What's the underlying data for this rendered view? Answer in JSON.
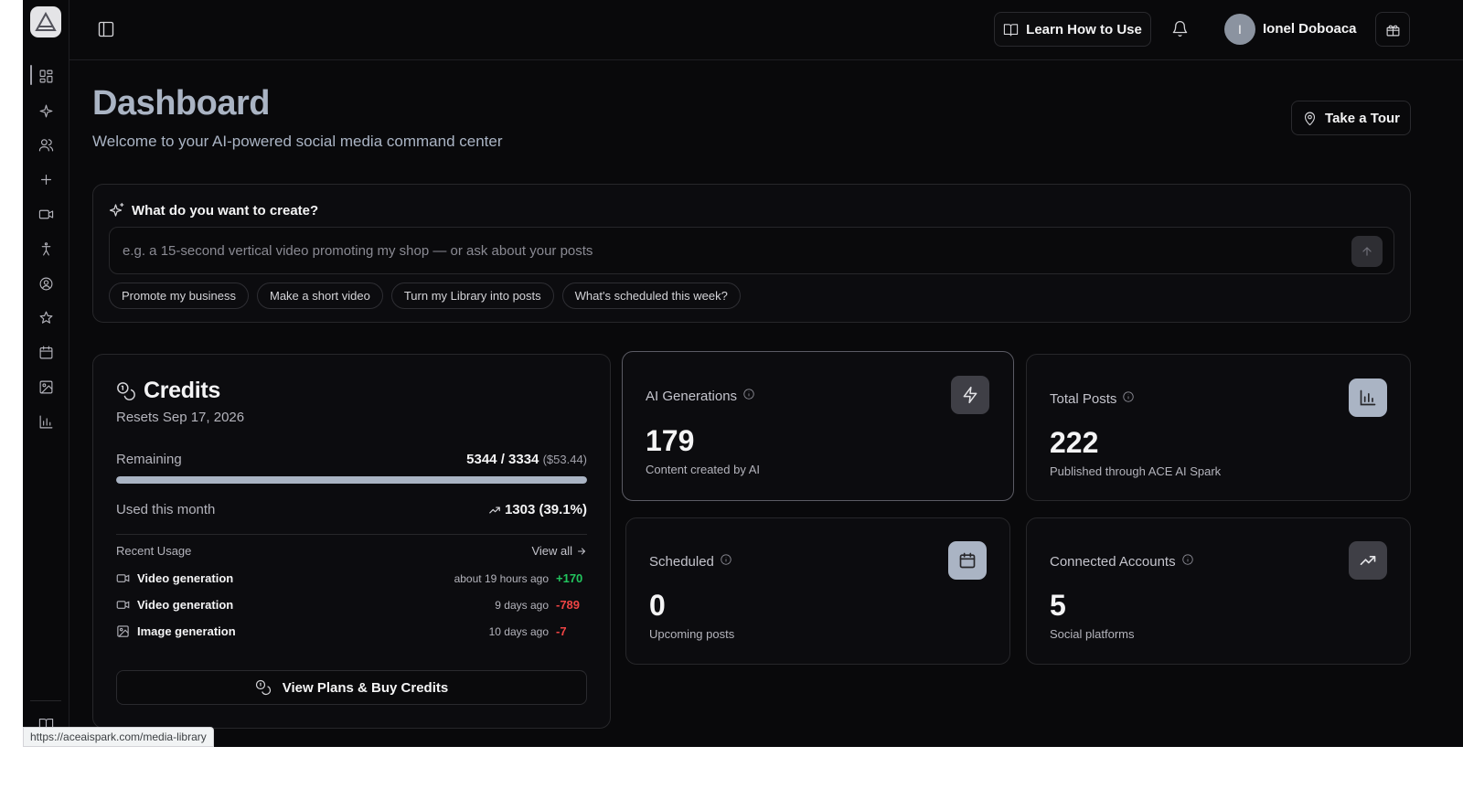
{
  "topbar": {
    "learn_label": "Learn How to Use",
    "user_initial": "I",
    "user_name": "Ionel Doboaca"
  },
  "header": {
    "title": "Dashboard",
    "subtitle": "Welcome to your AI-powered social media command center",
    "tour_label": "Take a Tour"
  },
  "create": {
    "title": "What do you want to create?",
    "placeholder": "e.g. a 15-second vertical video promoting my shop — or ask about your posts",
    "chips": [
      "Promote my business",
      "Make a short video",
      "Turn my Library into posts",
      "What's scheduled this week?"
    ]
  },
  "credits": {
    "title": "Credits",
    "resets": "Resets Sep 17, 2026",
    "remaining_label": "Remaining",
    "remaining_value": "5344 / 3334",
    "remaining_usd": "($53.44)",
    "remaining_fraction": 1.0,
    "used_label": "Used this month",
    "used_value": "1303 (39.1%)",
    "recent_label": "Recent Usage",
    "view_all": "View all",
    "usage": [
      {
        "name": "Video generation",
        "time": "about 19 hours ago",
        "delta": "+170",
        "kind": "video",
        "positive": true
      },
      {
        "name": "Video generation",
        "time": "9 days ago",
        "delta": "-789",
        "kind": "video",
        "positive": false
      },
      {
        "name": "Image generation",
        "time": "10 days ago",
        "delta": "-7",
        "kind": "image",
        "positive": false
      }
    ],
    "buy_label": "View Plans & Buy Credits"
  },
  "stats": {
    "ai": {
      "title": "AI Generations",
      "value": "179",
      "desc": "Content created by AI"
    },
    "posts": {
      "title": "Total Posts",
      "value": "222",
      "desc": "Published through ACE AI Spark"
    },
    "scheduled": {
      "title": "Scheduled",
      "value": "0",
      "desc": "Upcoming posts"
    },
    "accounts": {
      "title": "Connected Accounts",
      "value": "5",
      "desc": "Social platforms"
    }
  },
  "status_url": "https://aceaispark.com/media-library",
  "colors": {
    "accent": "#aab4c4",
    "positive": "#22c55e",
    "negative": "#ef4444",
    "background": "#09090b"
  }
}
